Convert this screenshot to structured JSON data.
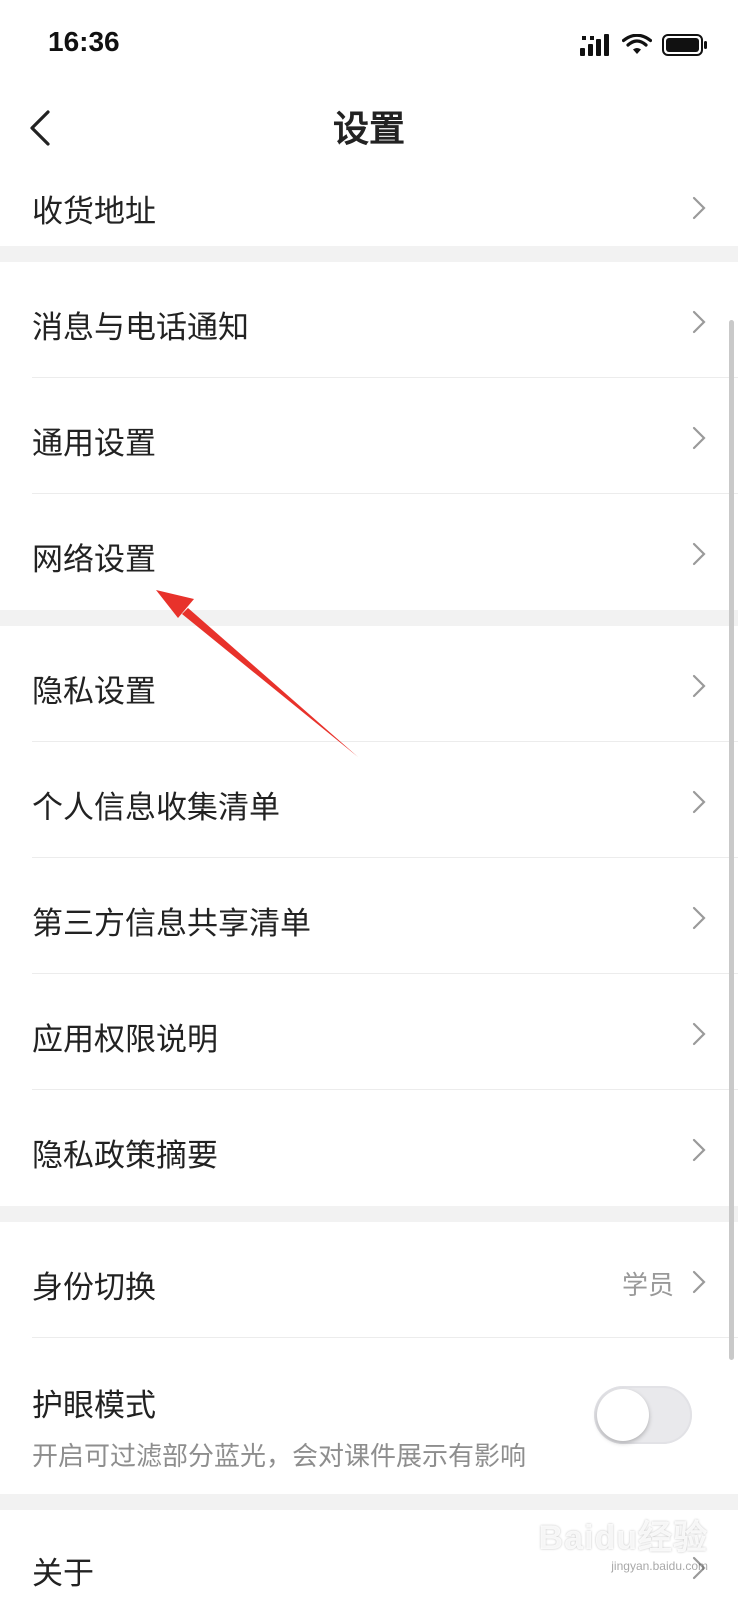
{
  "status_bar": {
    "time": "16:36"
  },
  "nav": {
    "title": "设置"
  },
  "rows": {
    "address": "收货地址",
    "notifications": "消息与电话通知",
    "general": "通用设置",
    "network": "网络设置",
    "privacy": "隐私设置",
    "personal_info": "个人信息收集清单",
    "third_party": "第三方信息共享清单",
    "permissions": "应用权限说明",
    "privacy_summary": "隐私政策摘要",
    "identity": "身份切换",
    "identity_value": "学员",
    "eye_mode": "护眼模式",
    "eye_mode_desc": "开启可过滤部分蓝光，会对课件展示有影响",
    "about": "关于"
  },
  "eye_mode_toggle": {
    "on": false
  },
  "watermark": {
    "main": "Baidu经验",
    "sub": "jingyan.baidu.com"
  },
  "colors": {
    "annotation_arrow": "#e8322b",
    "background": "#f2f2f2"
  }
}
